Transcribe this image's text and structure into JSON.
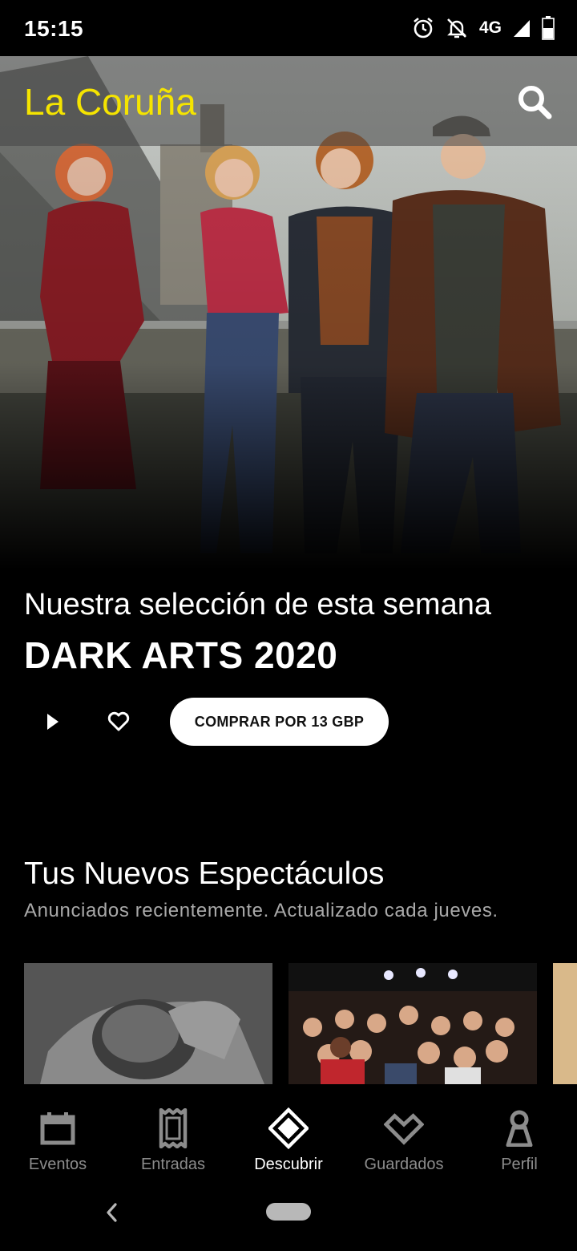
{
  "status_bar": {
    "time": "15:15",
    "network": "4G",
    "icons": [
      "alarm-icon",
      "bell-off-icon",
      "signal-icon",
      "battery-icon"
    ]
  },
  "header": {
    "city": "La Coruña",
    "search_icon": "search-icon"
  },
  "featured": {
    "label": "Nuestra selección de esta semana",
    "title": "DARK ARTS 2020",
    "play_icon": "play-icon",
    "favorite_icon": "heart-icon",
    "buy_label": "COMPRAR POR 13 GBP"
  },
  "new_shows": {
    "title": "Tus Nuevos Espectáculos",
    "subtitle": "Anunciados recientemente. Actualizado cada jueves."
  },
  "bottom_nav": {
    "items": [
      {
        "label": "Eventos",
        "icon": "calendar-icon"
      },
      {
        "label": "Entradas",
        "icon": "ticket-icon"
      },
      {
        "label": "Descubrir",
        "icon": "diamond-icon",
        "active": true
      },
      {
        "label": "Guardados",
        "icon": "heart-diamond-icon"
      },
      {
        "label": "Perfil",
        "icon": "person-icon"
      }
    ]
  },
  "colors": {
    "accent": "#f5e400",
    "background": "#000000",
    "inactive_nav": "#8c8c8c"
  }
}
